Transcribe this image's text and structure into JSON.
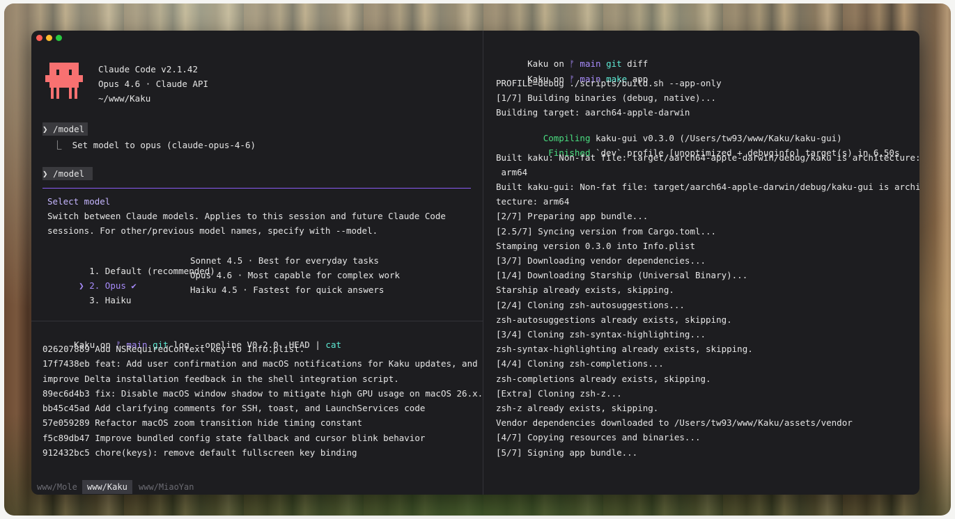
{
  "left_top": {
    "app_name": "Claude Code v2.1.42",
    "model_line": "Opus 4.6 · Claude API",
    "cwd": "~/www/Kaku",
    "cmd1": "❯ /model",
    "result1": "  ⎿  Set model to opus (claude-opus-4-6)",
    "cmd2": "❯ /model ",
    "select_title": "Select model",
    "select_desc1": "Switch between Claude models. Applies to this session and future Claude Code",
    "select_desc2": "sessions. For other/previous model names, specify with --model.",
    "options": [
      {
        "pointer": "  ",
        "num": "1. ",
        "name": "Default (recommended)",
        "check": "",
        "desc": "Sonnet 4.5 · Best for everyday tasks"
      },
      {
        "pointer": "❯ ",
        "num": "2. ",
        "name": "Opus",
        "check": " ✔",
        "desc": "Opus 4.6 · Most capable for complex work"
      },
      {
        "pointer": "  ",
        "num": "3. ",
        "name": "Haiku",
        "check": "",
        "desc": "Haiku 4.5 · Fastest for quick answers"
      }
    ]
  },
  "left_bottom": {
    "prompt_dir": "Kaku",
    "prompt_on": " on ",
    "branch_icon": "ᚠ",
    "branch": "main",
    "cmd_git": "git",
    "cmd_rest": " log --oneline V0.2.0..HEAD | ",
    "cmd_pipe": "cat",
    "lines": [
      "026207889 Add NSRequiredContext key to Info.plist.",
      "17f7438eb feat: Add user confirmation and macOS notifications for Kaku updates, and",
      "improve Delta installation feedback in the shell integration script.",
      "89ec6d4b3 fix: Disable macOS window shadow to mitigate high GPU usage on macOS 26.x.",
      "bb45c45ad Add clarifying comments for SSH, toast, and LaunchServices code",
      "57e059289 Refactor macOS zoom transition hide timing constant",
      "f5c89db47 Improve bundled config state fallback and cursor blink behavior",
      "912432bc5 chore(keys): remove default fullscreen key binding"
    ]
  },
  "right": {
    "prompt1": {
      "dir": "Kaku",
      "on": " on ",
      "icon": "ᚠ",
      "branch": "main",
      "cmd": "git",
      "args": " diff"
    },
    "prompt2": {
      "dir": "Kaku",
      "on": " on ",
      "icon": "ᚠ",
      "branch": "main",
      "cmd": "make",
      "args": " app"
    },
    "l3": "PROFILE=debug ./scripts/build.sh --app-only",
    "l4": "[1/7] Building binaries (debug, native)...",
    "l5": "Building target: aarch64-apple-darwin",
    "l6_kw": "   Compiling",
    "l6_rest": " kaku-gui v0.3.0 (/Users/tw93/www/Kaku/kaku-gui)",
    "l7_kw": "    Finished",
    "l7_rest": " `dev` profile [unoptimized + debuginfo] target(s) in 6.50s",
    "rest": [
      "Built kaku: Non-fat file: target/aarch64-apple-darwin/debug/kaku is architecture:",
      " arm64",
      "Built kaku-gui: Non-fat file: target/aarch64-apple-darwin/debug/kaku-gui is archi",
      "tecture: arm64",
      "[2/7] Preparing app bundle...",
      "[2.5/7] Syncing version from Cargo.toml...",
      "Stamping version 0.3.0 into Info.plist",
      "[3/7] Downloading vendor dependencies...",
      "[1/4] Downloading Starship (Universal Binary)...",
      "Starship already exists, skipping.",
      "[2/4] Cloning zsh-autosuggestions...",
      "zsh-autosuggestions already exists, skipping.",
      "[3/4] Cloning zsh-syntax-highlighting...",
      "zsh-syntax-highlighting already exists, skipping.",
      "[4/4] Cloning zsh-completions...",
      "zsh-completions already exists, skipping.",
      "[Extra] Cloning zsh-z...",
      "zsh-z already exists, skipping.",
      "Vendor dependencies downloaded to /Users/tw93/www/Kaku/assets/vendor",
      "[4/7] Copying resources and binaries...",
      "[5/7] Signing app bundle..."
    ]
  },
  "tabs": [
    {
      "label": "www/Mole"
    },
    {
      "label": "www/Kaku"
    },
    {
      "label": "www/MiaoYan"
    }
  ],
  "colors": {
    "accent_purple": "#8b5cf6",
    "logo": "#f87171",
    "terminal_bg": "#1d1d20"
  }
}
